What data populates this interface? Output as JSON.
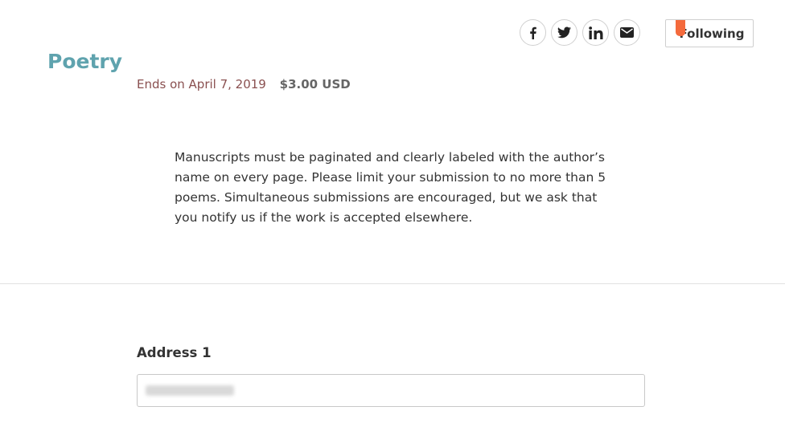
{
  "share": {
    "icons": [
      "facebook-icon",
      "twitter-icon",
      "linkedin-icon",
      "email-icon"
    ]
  },
  "follow": {
    "label": "Following",
    "marker_color": "#f46a3c"
  },
  "category": {
    "title": "Poetry",
    "ends": "Ends on April 7, 2019",
    "price": "$3.00 USD",
    "description": "Manuscripts must be paginated and clearly labeled with the author’s name on every page. Please limit your submission to no more than 5 poems. Simultaneous submissions are encouraged, but we ask that you notify us if the work is accepted elsewhere."
  },
  "form": {
    "address1": {
      "label": "Address 1",
      "value": ""
    }
  },
  "colors": {
    "title": "#5fa3ae",
    "ends": "#8a5050",
    "accent": "#f46a3c"
  }
}
